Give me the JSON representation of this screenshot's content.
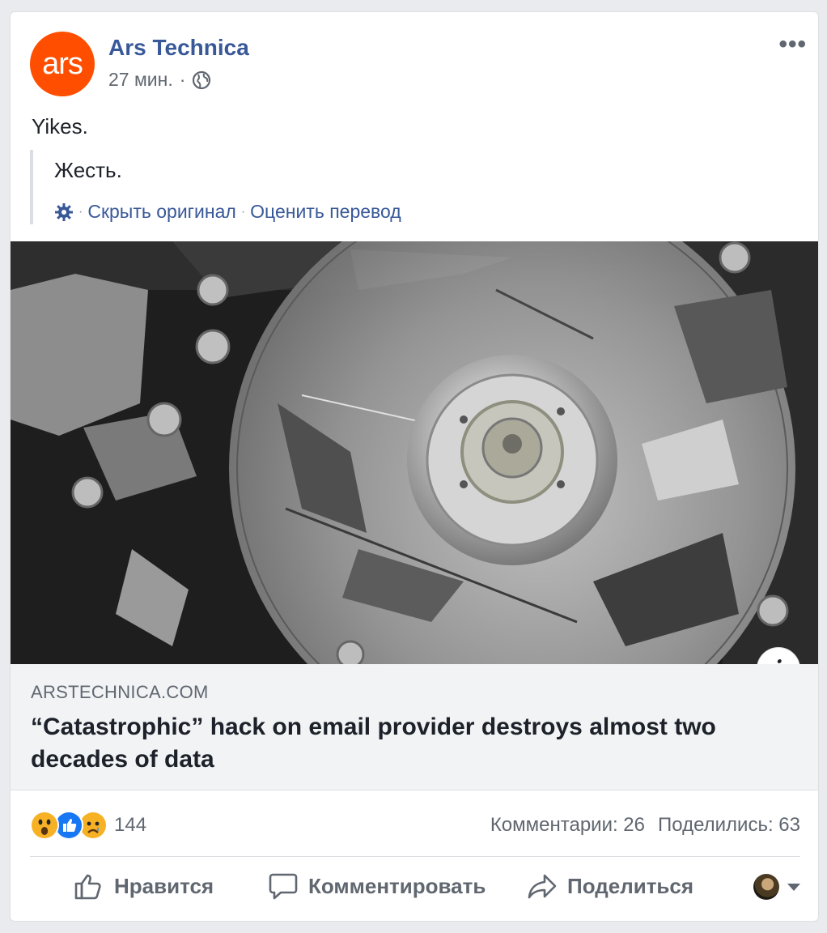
{
  "post": {
    "page_name": "Ars Technica",
    "avatar_text": "ars",
    "time": "27 мин.",
    "separator": "·",
    "more": "•••",
    "text": "Yikes.",
    "translation": {
      "text": "Жесть.",
      "hide_original": "Скрыть оригинал",
      "rate_translation": "Оценить перевод",
      "dot": "·"
    }
  },
  "link": {
    "domain": "ARSTECHNICA.COM",
    "headline": "“Catastrophic” hack on email provider destroys almost two decades of data",
    "info_icon": "i"
  },
  "engagement": {
    "reaction_count": "144",
    "reaction_icons": [
      "wow-icon",
      "like-icon",
      "sad-icon"
    ],
    "comments": "Комментарии: 26",
    "shares": "Поделились: 63"
  },
  "actions": {
    "like": "Нравится",
    "comment": "Комментировать",
    "share": "Поделиться"
  },
  "colors": {
    "link_blue": "#385898",
    "ars_orange": "#ff4e00",
    "secondary_text": "#606770",
    "like_blue": "#1877f2",
    "emoji_yellow": "#f7b125"
  }
}
